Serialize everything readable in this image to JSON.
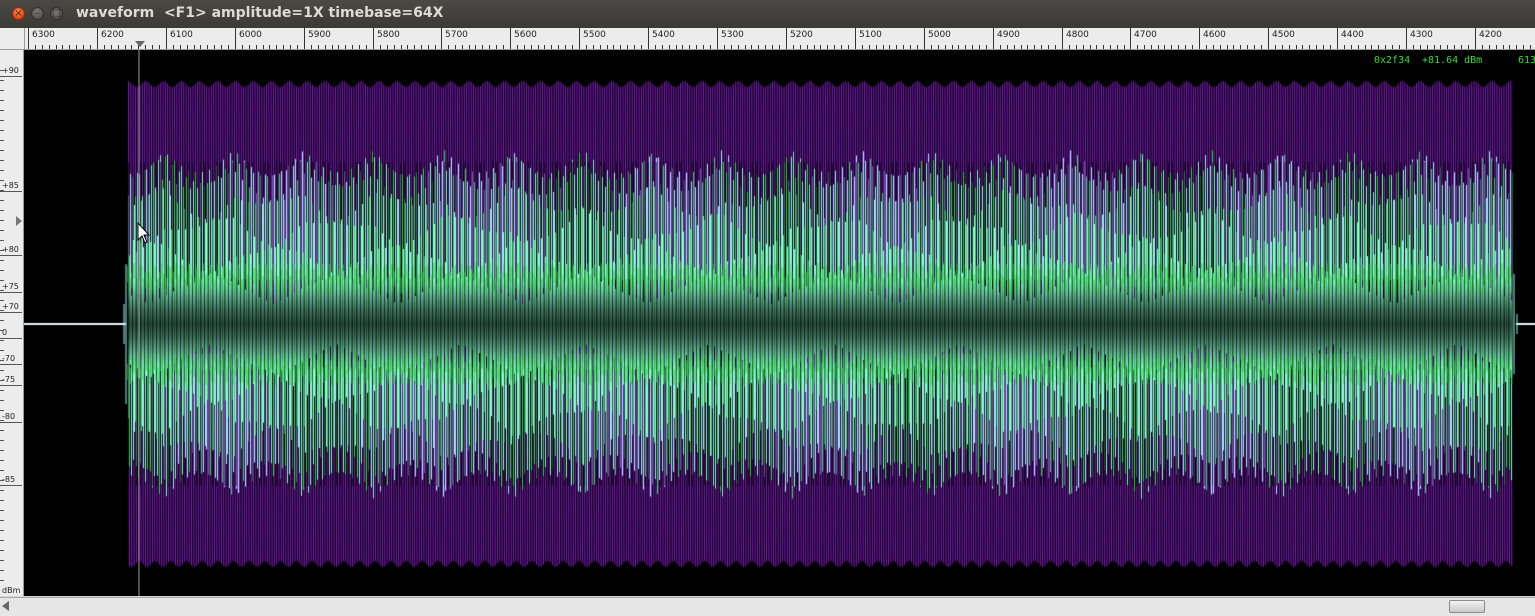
{
  "window": {
    "title": "waveform  <F1> amplitude=1X timebase=64X",
    "close_glyph": "×",
    "minimize_glyph": "–",
    "maximize_glyph": "□"
  },
  "ruler": {
    "labels": [
      "6300",
      "6200",
      "6100",
      "6000",
      "5900",
      "5800",
      "5700",
      "5600",
      "5500",
      "5400",
      "5300",
      "5200",
      "5100",
      "5000",
      "4900",
      "4800",
      "4700",
      "4600",
      "4500",
      "4400",
      "4300",
      "4200"
    ]
  },
  "yaxis": {
    "labels": [
      "+90",
      "+85",
      "+80",
      "+75",
      "+70",
      "0",
      "-70",
      "-75",
      "-80",
      "-85",
      "dBm"
    ]
  },
  "readout": {
    "hex": "0x2f34",
    "level": "+81.64 dBm",
    "sample": "613"
  },
  "colors": {
    "background": "#000000",
    "wave_outer": "#8b1ed0",
    "wave_cyan": "#9ef2f2",
    "wave_green": "#34d64a",
    "baseline": "#e8f6ff",
    "readout": "#3fd73f"
  },
  "icons": {
    "close": "close-icon",
    "minimize": "minimize-icon",
    "maximize": "maximize-icon",
    "mouse": "mouse-pointer-icon",
    "scroll_left": "arrow-left-icon"
  }
}
